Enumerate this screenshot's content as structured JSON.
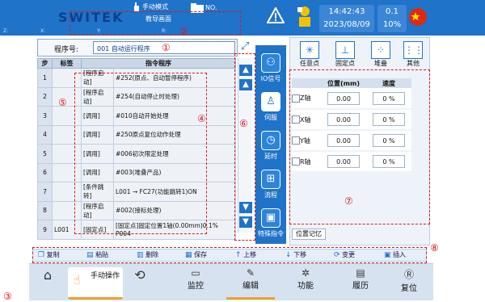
{
  "header": {
    "brand": "SWITEK",
    "coords": [
      "Z:",
      "X:",
      "Y:",
      "R:"
    ],
    "mode_label": "手动模式",
    "mode_sub": "教导画面",
    "folder_label": "NO.",
    "time": "14:42:43",
    "date": "2023/08/09",
    "speed_a": "0.1",
    "speed_b": "10%",
    "icons": {
      "warning": "warning-icon",
      "robot": "robot-status-icon",
      "flag": "china-flag-icon"
    }
  },
  "program": {
    "label": "程序号:",
    "value": "001 自动运行程序"
  },
  "table": {
    "headers": [
      "步",
      "标签",
      "指令程序"
    ],
    "rows": [
      {
        "step": "1",
        "tag": "",
        "cat": "[程序启动]",
        "cmd": "#252(原点、自动暂停程序)"
      },
      {
        "step": "2",
        "tag": "",
        "cat": "[程序启动]",
        "cmd": "#254(自动停止时处理)"
      },
      {
        "step": "3",
        "tag": "",
        "cat": "[调用]",
        "cmd": "#010自动开始处理"
      },
      {
        "step": "4",
        "tag": "",
        "cat": "[调用]",
        "cmd": "#250原点复位动作处理"
      },
      {
        "step": "5",
        "tag": "",
        "cat": "[调用]",
        "cmd": "#006初次限定处理"
      },
      {
        "step": "6",
        "tag": "",
        "cat": "[调用]",
        "cmd": "#003(堆叠产品)"
      },
      {
        "step": "7",
        "tag": "",
        "cat": "[条件跳转]",
        "cmd": "L001 → FC27(功能跳转1)ON"
      },
      {
        "step": "8",
        "tag": "",
        "cat": "[程序启动]",
        "cmd": "#002(接标处理)"
      },
      {
        "step": "9",
        "tag": "L001",
        "cat": "[固定点]",
        "cmd": "[固定点]固定位置1轴(0.00mm)0.1% P004"
      }
    ]
  },
  "midnav": [
    {
      "label": "IO信号",
      "icon": "io-signal-icon"
    },
    {
      "label": "伺服",
      "icon": "servo-icon"
    },
    {
      "label": "延时",
      "icon": "clock-icon"
    },
    {
      "label": "流程",
      "icon": "flow-icon"
    },
    {
      "label": "特殊指令",
      "icon": "chip-icon"
    }
  ],
  "point_types": [
    {
      "label": "任意点",
      "icon": "any-point-icon"
    },
    {
      "label": "固定点",
      "icon": "fixed-point-icon"
    },
    {
      "label": "堆叠",
      "icon": "stack-icon"
    },
    {
      "label": "其他",
      "icon": "other-icon"
    }
  ],
  "axis": {
    "headers": [
      "位置(mm)",
      "速度"
    ],
    "rows": [
      {
        "axis": "Z轴",
        "pos": "0.00",
        "speed": "0 %"
      },
      {
        "axis": "X轴",
        "pos": "0.00",
        "speed": "0 %"
      },
      {
        "axis": "Y轴",
        "pos": "0.00",
        "speed": "0 %"
      },
      {
        "axis": "R轴",
        "pos": "0.00",
        "speed": "0 %"
      }
    ],
    "memory_button": "位置记忆"
  },
  "toolbar": {
    "copy": "复制",
    "paste": "粘贴",
    "delete": "删除",
    "save": "保存",
    "up": "上移",
    "down": "下移",
    "change": "变更",
    "insert": "插入"
  },
  "bottom": {
    "manual_op": "手动操作",
    "monitor": "监控",
    "edit": "编辑",
    "function": "功能",
    "history": "履历",
    "reset": "复位"
  },
  "annotations": [
    "①",
    "②",
    "③",
    "④",
    "⑤",
    "⑥",
    "⑦",
    "⑧"
  ]
}
